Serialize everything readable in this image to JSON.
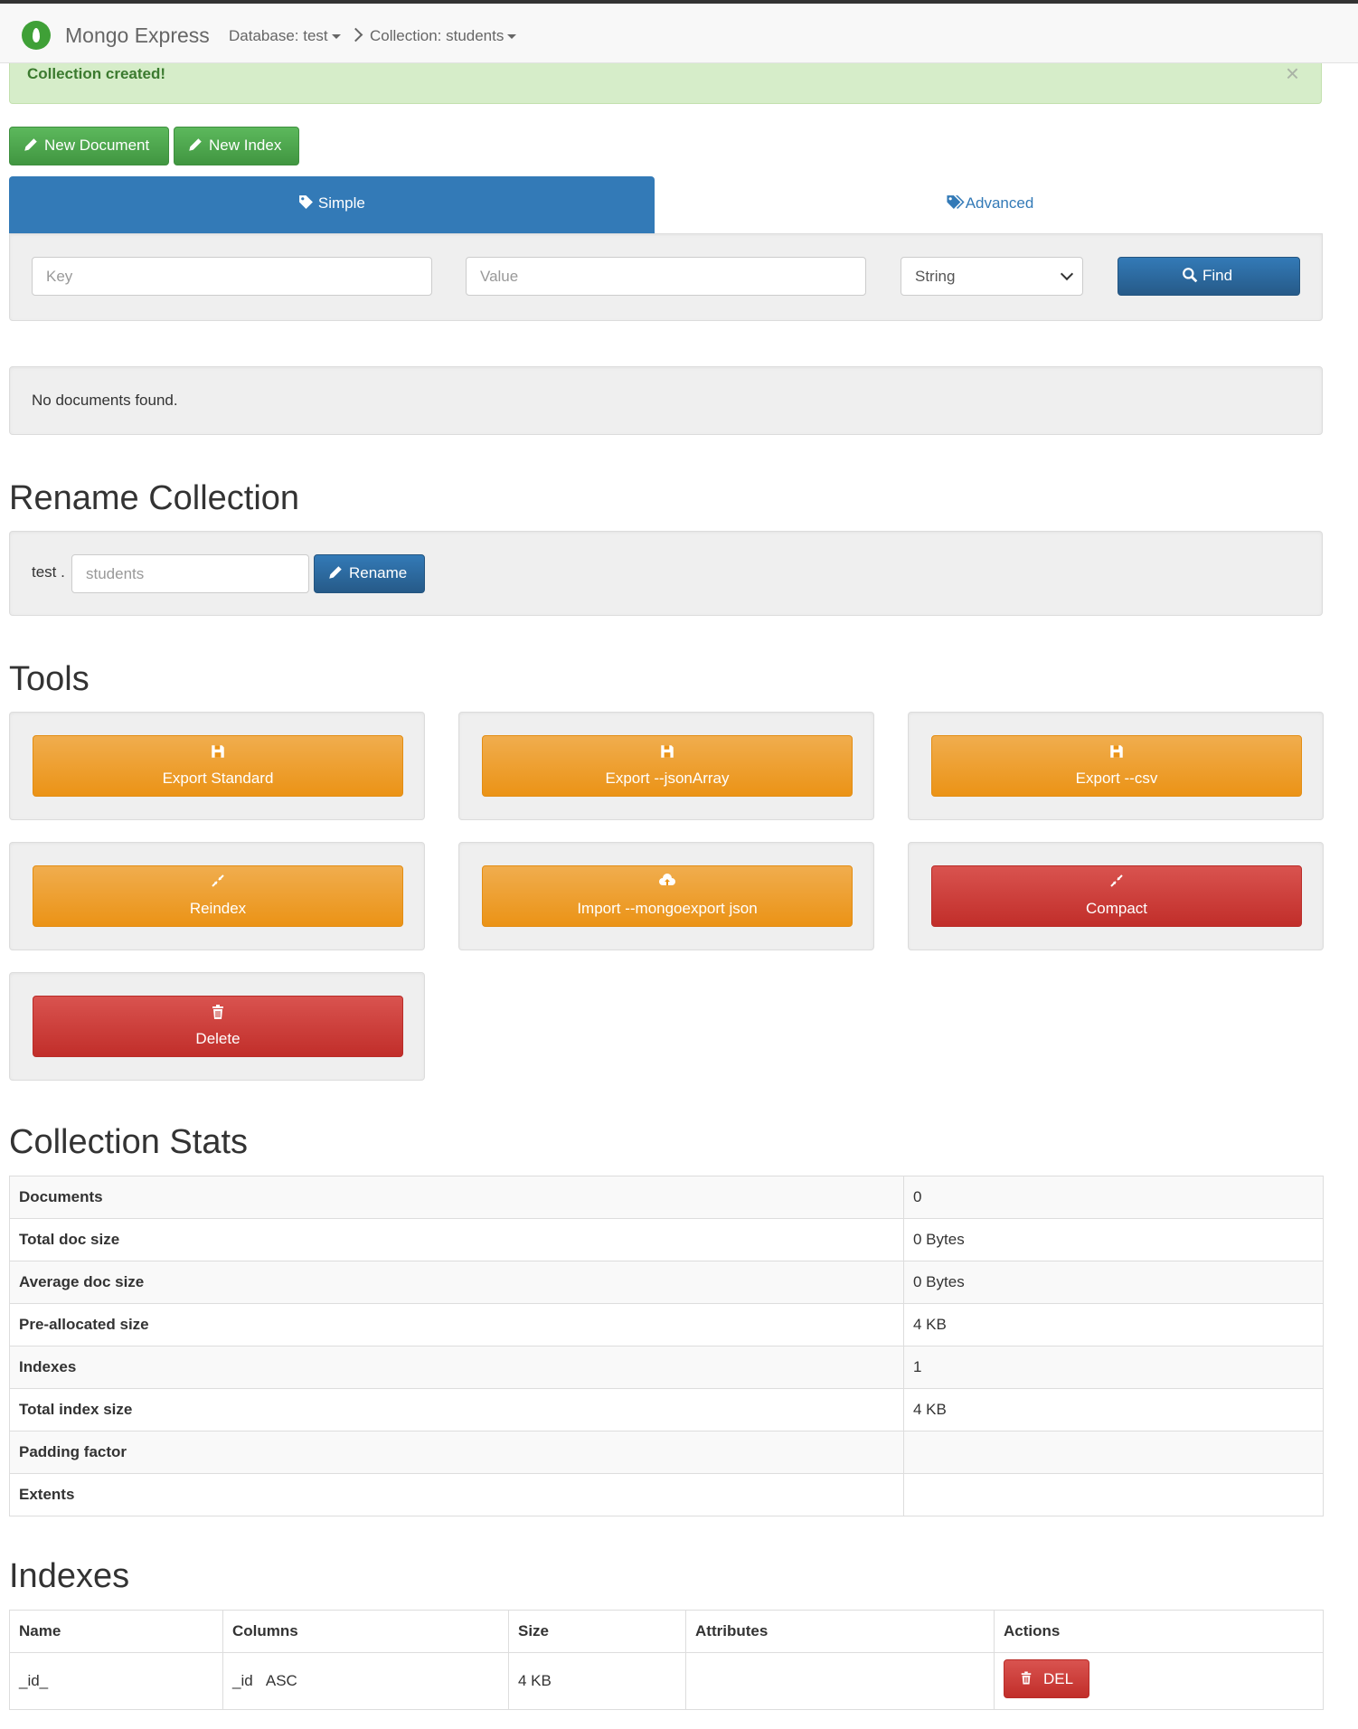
{
  "nav": {
    "brand": "Mongo Express",
    "database_label": "Database: test",
    "collection_label": "Collection: students"
  },
  "alert": {
    "message": "Collection created!",
    "close": "×"
  },
  "actions": {
    "new_document": "New Document",
    "new_index": "New Index"
  },
  "tabs": {
    "simple": "Simple",
    "advanced": "Advanced"
  },
  "search": {
    "key_placeholder": "Key",
    "value_placeholder": "Value",
    "type_selected": "String",
    "find_label": "Find"
  },
  "documents": {
    "empty_message": "No documents found."
  },
  "rename": {
    "heading": "Rename Collection",
    "db_prefix": "test .",
    "collection_placeholder": "students",
    "button_label": "Rename"
  },
  "tools": {
    "heading": "Tools",
    "buttons": [
      {
        "label": "Export Standard",
        "icon": "save-icon",
        "color": "#f0ad4e"
      },
      {
        "label": "Export --jsonArray",
        "icon": "save-icon",
        "color": "#f0ad4e"
      },
      {
        "label": "Export --csv",
        "icon": "save-icon",
        "color": "#f0ad4e"
      },
      {
        "label": "Reindex",
        "icon": "compress-icon",
        "color": "#f0ad4e"
      },
      {
        "label": "Import --mongoexport json",
        "icon": "cloud-upload-icon",
        "color": "#f0ad4e"
      },
      {
        "label": "Compact",
        "icon": "compress-icon",
        "color": "#d9534f"
      },
      {
        "label": "Delete",
        "icon": "trash-icon",
        "color": "#d9534f"
      }
    ]
  },
  "stats": {
    "heading": "Collection Stats",
    "rows": [
      {
        "label": "Documents",
        "value": "0"
      },
      {
        "label": "Total doc size",
        "value": "0 Bytes"
      },
      {
        "label": "Average doc size",
        "value": "0 Bytes"
      },
      {
        "label": "Pre-allocated size",
        "value": "4 KB"
      },
      {
        "label": "Indexes",
        "value": "1"
      },
      {
        "label": "Total index size",
        "value": "4 KB"
      },
      {
        "label": "Padding factor",
        "value": ""
      },
      {
        "label": "Extents",
        "value": ""
      }
    ]
  },
  "indexes": {
    "heading": "Indexes",
    "columns": [
      "Name",
      "Columns",
      "Size",
      "Attributes",
      "Actions"
    ],
    "rows": [
      {
        "name": "_id_",
        "column_field": "_id",
        "column_order": "ASC",
        "size": "4 KB",
        "attributes": "",
        "action": "DEL"
      }
    ]
  },
  "colors": {
    "primary": "#337ab7",
    "success": "#5cb85c",
    "warning": "#f0ad4e",
    "danger": "#d9534f",
    "alert_bg": "#d6edc9"
  }
}
